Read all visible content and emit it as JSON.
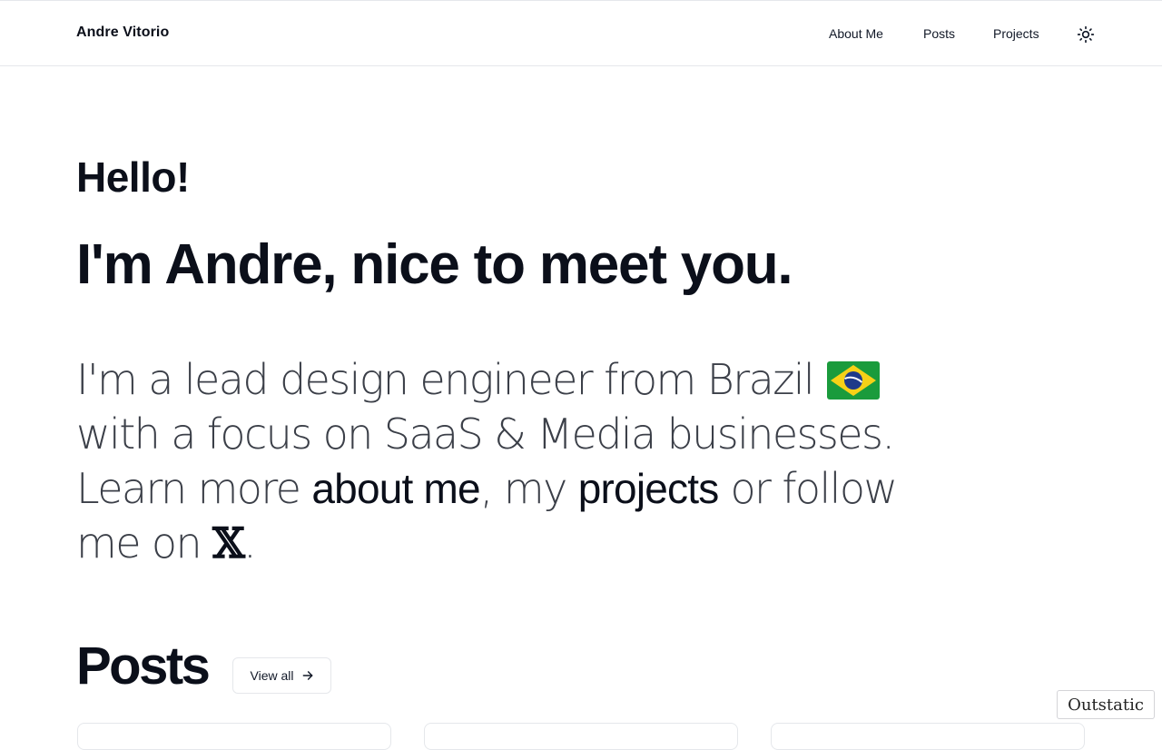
{
  "header": {
    "brand": "Andre Vitorio",
    "nav": [
      "About Me",
      "Posts",
      "Projects"
    ],
    "theme_toggle_icon": "sun-icon"
  },
  "hero": {
    "greeting": "Hello!",
    "intro": "I'm Andre, nice to meet you.",
    "bio": {
      "part1": "I'm a lead design engineer from Brazil",
      "flag_icon": "brazil-flag-icon",
      "part2": "with a focus on SaaS & Media businesses. Learn more",
      "link_about": "about me",
      "sep1": ",",
      "word_my": "my",
      "link_projects": "projects",
      "part3": "or follow me on",
      "link_x": "𝕏",
      "end": "."
    }
  },
  "posts_section": {
    "title": "Posts",
    "view_all_label": "View all",
    "view_all_icon": "arrow-right-icon"
  },
  "badge": {
    "label": "Outstatic"
  },
  "colors": {
    "text": "#0b0f1a",
    "muted": "#3b3f48",
    "border": "#e5e7eb"
  }
}
